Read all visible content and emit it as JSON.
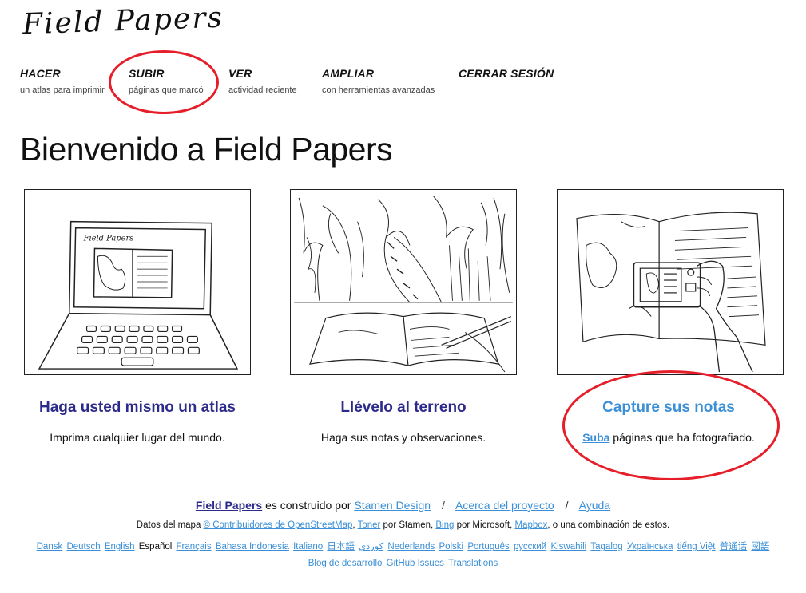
{
  "logo": "Field Papers",
  "nav": [
    {
      "label": "HACER",
      "sub": "un atlas para imprimir"
    },
    {
      "label": "SUBIR",
      "sub": "páginas que marcó"
    },
    {
      "label": "VER",
      "sub": "actividad reciente"
    },
    {
      "label": "AMPLIAR",
      "sub": "con herramientas avanzadas"
    },
    {
      "label": "CERRAR SESIÓN",
      "sub": ""
    }
  ],
  "page_title": "Bienvenido a Field Papers",
  "cards": [
    {
      "title": "Haga usted mismo un atlas",
      "desc": "Imprima cualquier lugar del mundo.",
      "illustration": "laptop-sketch",
      "sketch_logo": "Field Papers"
    },
    {
      "title": "Llévelo al terreno",
      "desc": "Haga sus notas y observaciones.",
      "illustration": "jungle-notebook-sketch"
    },
    {
      "title": "Capture sus notas",
      "desc_link": "Suba",
      "desc": " páginas que ha fotografiado.",
      "illustration": "camera-photo-sketch"
    }
  ],
  "footer": {
    "brand": "Field Papers",
    "built_by": " es construido por ",
    "stamen": "Stamen Design",
    "separator": "/",
    "about": "Acerca del proyecto",
    "help": "Ayuda"
  },
  "credits": {
    "prefix": "Datos del mapa ",
    "osm": "© Contribuidores de OpenStreetMap",
    "sep1": ", ",
    "toner": "Toner",
    "by_stamen": " por Stamen, ",
    "bing": "Bing",
    "by_microsoft": " por Microsoft, ",
    "mapbox": "Mapbox",
    "suffix": ", o una combinación de estos."
  },
  "languages": [
    "Dansk",
    "Deutsch",
    "English",
    "Español",
    "Français",
    "Bahasa Indonesia",
    "Italiano",
    "日本語",
    "کوردی",
    "Nederlands",
    "Polski",
    "Português",
    "русский",
    "Kiswahili",
    "Tagalog",
    "Українська",
    "tiếng Việt",
    "普通话",
    "國語"
  ],
  "current_language": "Español",
  "dev_links": [
    "Blog de desarrollo",
    "GitHub Issues",
    "Translations"
  ],
  "colors": {
    "link_dark": "#2c2a8a",
    "link_light": "#3b8fd6",
    "annotation_red": "#e61e2a"
  }
}
